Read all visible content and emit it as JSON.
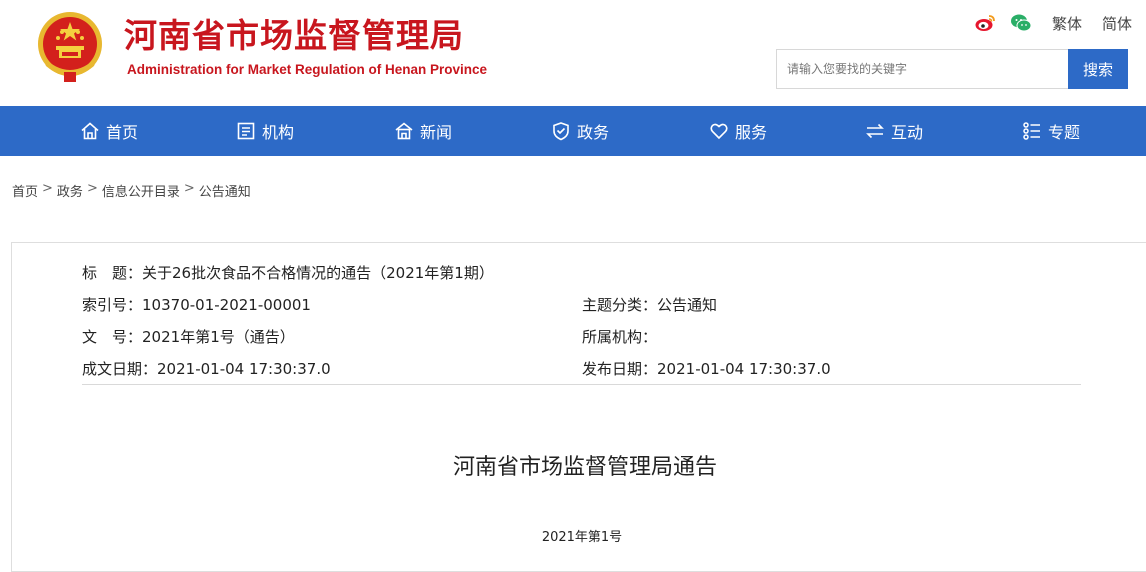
{
  "header": {
    "title_cn": "河南省市场监督管理局",
    "title_en": "Administration for Market Regulation of Henan Province",
    "brand_color": "#c8161e",
    "emblem_icon": "national-emblem-icon"
  },
  "top_tools": {
    "weibo_icon": "weibo-icon",
    "wechat_icon": "wechat-icon",
    "traditional_label": "繁体",
    "simplified_label": "简体"
  },
  "search": {
    "placeholder": "请输入您要找的关键字",
    "button_label": "搜索"
  },
  "nav": {
    "color": "#2d6ac7",
    "items": [
      {
        "label": "首页",
        "icon": "home-icon"
      },
      {
        "label": "机构",
        "icon": "org-list-icon"
      },
      {
        "label": "新闻",
        "icon": "news-house-icon"
      },
      {
        "label": "政务",
        "icon": "shield-icon"
      },
      {
        "label": "服务",
        "icon": "heart-icon"
      },
      {
        "label": "互动",
        "icon": "exchange-arrows-icon"
      },
      {
        "label": "专题",
        "icon": "topic-list-icon"
      }
    ]
  },
  "breadcrumb": {
    "items": [
      "首页",
      "政务",
      "信息公开目录",
      "公告通知"
    ],
    "separator": ">"
  },
  "meta": {
    "title_label": "标　题：",
    "title_value": "关于26批次食品不合格情况的通告（2021年第1期）",
    "index_label": "索引号：",
    "index_value": "10370-01-2021-00001",
    "category_label": "主题分类：",
    "category_value": "公告通知",
    "doc_no_label": "文　号：",
    "doc_no_value": "2021年第1号（通告）",
    "org_label": "所属机构：",
    "org_value": "",
    "created_label": "成文日期：",
    "created_value": "2021-01-04 17:30:37.0",
    "published_label": "发布日期：",
    "published_value": "2021-01-04 17:30:37.0"
  },
  "document": {
    "heading": "河南省市场监督管理局通告",
    "number": "2021年第1号"
  }
}
